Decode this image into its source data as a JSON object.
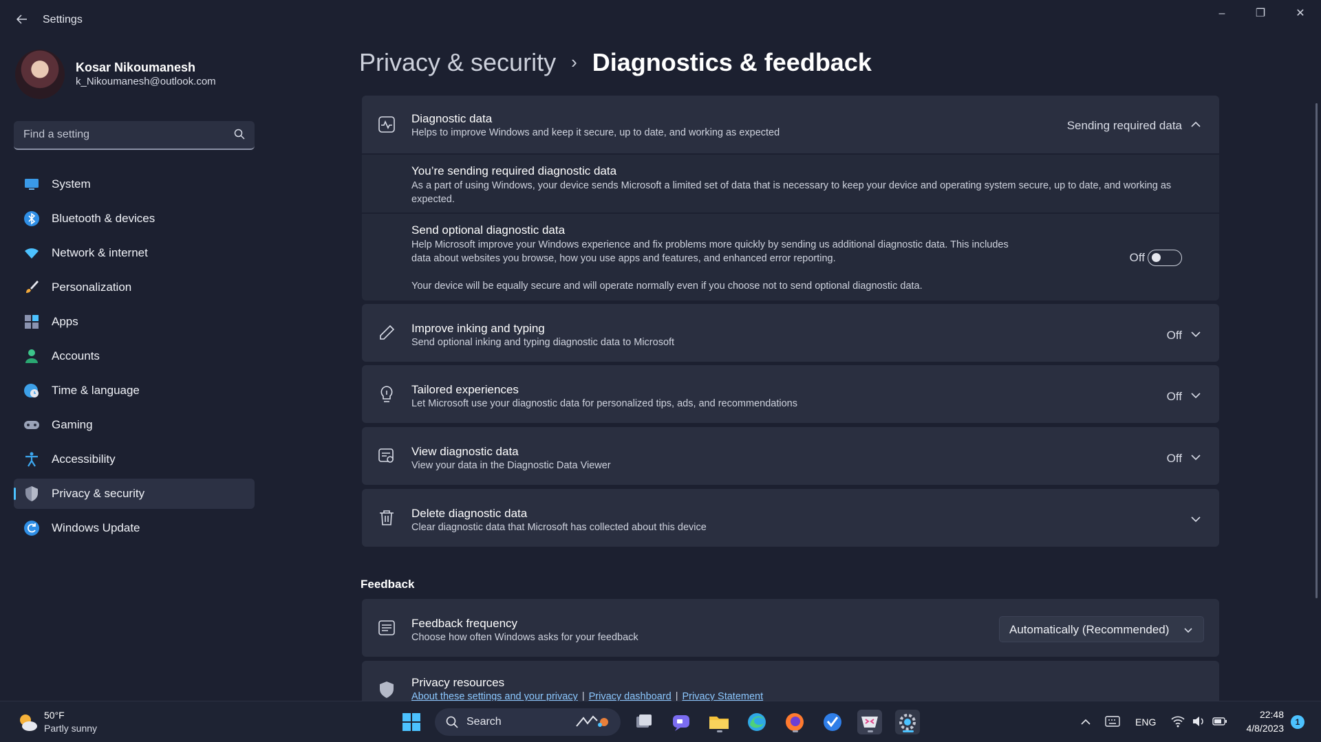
{
  "window": {
    "title": "Settings",
    "controls": {
      "minimize": "–",
      "maximize": "❐",
      "close": "✕"
    }
  },
  "profile": {
    "name": "Kosar Nikoumanesh",
    "email": "k_Nikoumanesh@outlook.com"
  },
  "search": {
    "placeholder": "Find a setting"
  },
  "sidebar": {
    "items": [
      {
        "label": "System",
        "icon": "system-icon",
        "color": "#3a9ae8"
      },
      {
        "label": "Bluetooth & devices",
        "icon": "bluetooth-icon",
        "color": "#2f8fe6"
      },
      {
        "label": "Network & internet",
        "icon": "wifi-icon",
        "color": "#4cc2ff"
      },
      {
        "label": "Personalization",
        "icon": "brush-icon",
        "color": "#f2a93b"
      },
      {
        "label": "Apps",
        "icon": "apps-icon",
        "color": "#8a93b0"
      },
      {
        "label": "Accounts",
        "icon": "accounts-icon",
        "color": "#3dc58b"
      },
      {
        "label": "Time & language",
        "icon": "globe-clock-icon",
        "color": "#3da0e8"
      },
      {
        "label": "Gaming",
        "icon": "gamepad-icon",
        "color": "#9aa3b8"
      },
      {
        "label": "Accessibility",
        "icon": "accessibility-icon",
        "color": "#3da8f0"
      },
      {
        "label": "Privacy & security",
        "icon": "shield-icon",
        "color": "#8a90a4"
      },
      {
        "label": "Windows Update",
        "icon": "update-icon",
        "color": "#2f8fe6"
      }
    ],
    "active_index": 9
  },
  "breadcrumb": {
    "parent": "Privacy & security",
    "separator": "›",
    "current": "Diagnostics & feedback"
  },
  "diagnostic_data": {
    "title": "Diagnostic data",
    "description": "Helps to improve Windows and keep it secure, up to date, and working as expected",
    "value": "Sending required data",
    "required": {
      "title": "You’re sending required diagnostic data",
      "text": "As a part of using Windows, your device sends Microsoft a limited set of data that is necessary to keep your device and operating system secure, up to date, and working as expected."
    },
    "optional": {
      "title": "Send optional diagnostic data",
      "text": "Help Microsoft improve your Windows experience and fix problems more quickly by sending us additional diagnostic data. This includes data about websites you browse, how you use apps and features, and enhanced error reporting.",
      "note": "Your device will be equally secure and will operate normally even if you choose not to send optional diagnostic data.",
      "state_label": "Off"
    }
  },
  "settings": [
    {
      "title": "Improve inking and typing",
      "description": "Send optional inking and typing diagnostic data to Microsoft",
      "value": "Off",
      "icon": "pen-icon"
    },
    {
      "title": "Tailored experiences",
      "description": "Let Microsoft use your diagnostic data for personalized tips, ads, and recommendations",
      "value": "Off",
      "icon": "lightbulb-icon"
    },
    {
      "title": "View diagnostic data",
      "description": "View your data in the Diagnostic Data Viewer",
      "value": "Off",
      "icon": "data-viewer-icon"
    },
    {
      "title": "Delete diagnostic data",
      "description": "Clear diagnostic data that Microsoft has collected about this device",
      "value": "",
      "icon": "trash-icon"
    }
  ],
  "feedback": {
    "section_title": "Feedback",
    "frequency": {
      "title": "Feedback frequency",
      "description": "Choose how often Windows asks for your feedback",
      "selected": "Automatically (Recommended)"
    }
  },
  "privacy_resources": {
    "title": "Privacy resources",
    "links": [
      "About these settings and your privacy",
      "Privacy dashboard",
      "Privacy Statement"
    ]
  },
  "taskbar": {
    "weather": {
      "temp": "50°F",
      "desc": "Partly sunny"
    },
    "search_label": "Search",
    "tray": {
      "language": "ENG",
      "time": "22:48",
      "date": "4/8/2023",
      "notification_count": "1"
    }
  },
  "colors": {
    "accent": "#4cc2ff",
    "background": "#1c2030",
    "card": "#2a2f40"
  }
}
